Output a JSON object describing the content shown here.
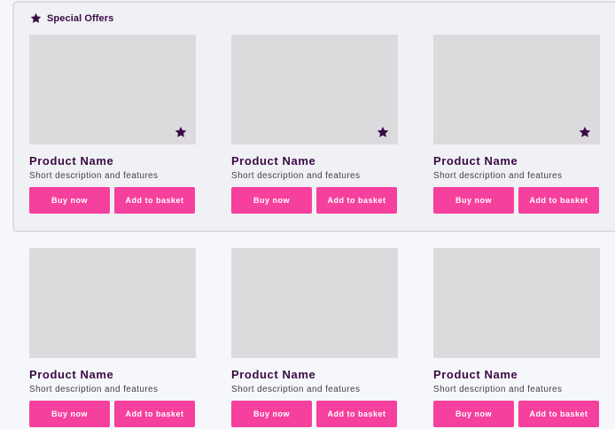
{
  "featured": {
    "title": "Special Offers",
    "icon": "star-icon",
    "products": [
      {
        "name": "Product Name",
        "description": "Short description and features",
        "buy_label": "Buy now",
        "basket_label": "Add to basket",
        "badge_icon": "star-icon"
      },
      {
        "name": "Product Name",
        "description": "Short description and features",
        "buy_label": "Buy now",
        "basket_label": "Add to basket",
        "badge_icon": "star-icon"
      },
      {
        "name": "Product Name",
        "description": "Short description and features",
        "buy_label": "Buy now",
        "basket_label": "Add to basket",
        "badge_icon": "star-icon"
      }
    ]
  },
  "products": [
    {
      "name": "Product Name",
      "description": "Short description and features",
      "buy_label": "Buy now",
      "basket_label": "Add to basket"
    },
    {
      "name": "Product Name",
      "description": "Short description and features",
      "buy_label": "Buy now",
      "basket_label": "Add to basket"
    },
    {
      "name": "Product Name",
      "description": "Short description and features",
      "buy_label": "Buy now",
      "basket_label": "Add to basket"
    }
  ],
  "colors": {
    "accent": "#f6409d",
    "text": "#3b0a45",
    "placeholder": "#dcdadd",
    "panel": "#f0f1f4"
  }
}
